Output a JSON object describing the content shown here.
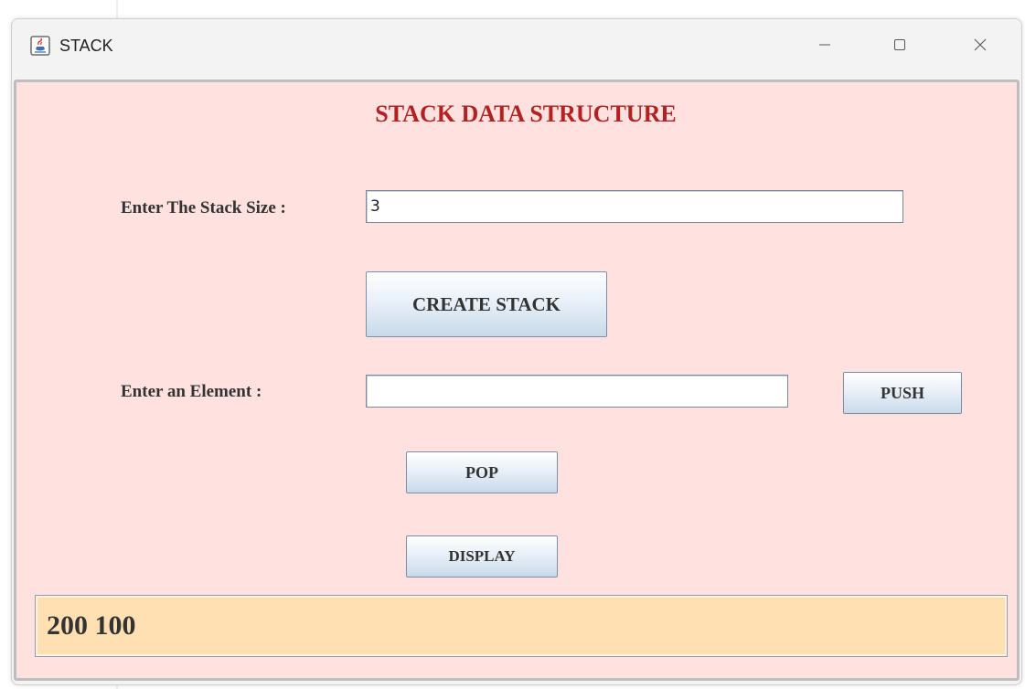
{
  "window": {
    "title": "STACK",
    "icon": "java-cup-icon",
    "controls": {
      "minimize_glyph": "—",
      "maximize_glyph": "☐",
      "close_glyph": "✕"
    }
  },
  "form": {
    "heading": "STACK DATA STRUCTURE",
    "stack_size_label": "Enter The Stack Size :",
    "stack_size_value": "3",
    "create_button": "CREATE STACK",
    "element_label": "Enter an Element :",
    "element_value": "",
    "push_button": "PUSH",
    "pop_button": "POP",
    "display_button": "DISPLAY"
  },
  "output": {
    "text": "200 100"
  },
  "colors": {
    "panel_background": "#ffe1df",
    "heading": "#b22222",
    "output_background": "#ffe0b2"
  }
}
